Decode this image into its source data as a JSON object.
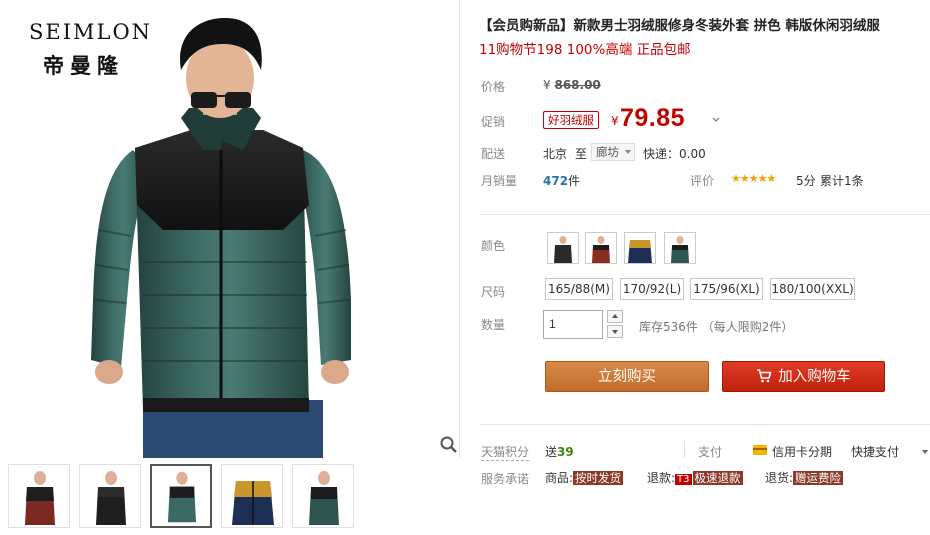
{
  "brand": {
    "name_en": "SEIMLON",
    "name_cn": "帝曼隆"
  },
  "product": {
    "title": "【会员购新品】新款男士羽绒服修身冬装外套 拼色 韩版休闲羽绒服",
    "subtitle": "11购物节198 100%高端 正品包邮"
  },
  "price": {
    "label": "价格",
    "currency": "¥",
    "original": "868.00",
    "promo_label": "促销",
    "promo_tag": "好羽绒服",
    "promo_value": "79.85"
  },
  "shipping": {
    "label": "配送",
    "from": "北京",
    "to_word": "至",
    "destination": "廊坊",
    "fee_text": "快递：0.00"
  },
  "sales": {
    "label": "月销量",
    "count": "472",
    "unit": "件",
    "rating_label": "评价",
    "stars": "★★★★★",
    "score_text": "5分",
    "review_text": "累计1条"
  },
  "color": {
    "label": "颜色",
    "swatches": [
      "brown-black",
      "red-black",
      "navy-gold",
      "green-black"
    ]
  },
  "size": {
    "label": "尺码",
    "options": [
      "165/88(M)",
      "170/92(L)",
      "175/96(XL)",
      "180/100(XXL)"
    ]
  },
  "quantity": {
    "label": "数量",
    "value": "1",
    "stock_text": "库存536件 （每人限购2件）"
  },
  "buttons": {
    "buy_now": "立刻购买",
    "add_to_cart": "加入购物车"
  },
  "points": {
    "label": "天猫积分",
    "prefix": "送",
    "value": "39"
  },
  "payment": {
    "label": "支付",
    "credit_card": "信用卡分期",
    "quick_pay": "快捷支付"
  },
  "service": {
    "label": "服务承诺",
    "goods_prefix": "商品:",
    "goods_tag": "按时发货",
    "return_prefix": "退款:",
    "return_t3": "T3",
    "return_tag": "极速退款",
    "exchange_prefix": "退货:",
    "exchange_tag": "赠运费险"
  },
  "thumbnail_count": 5,
  "active_thumbnail": 3
}
